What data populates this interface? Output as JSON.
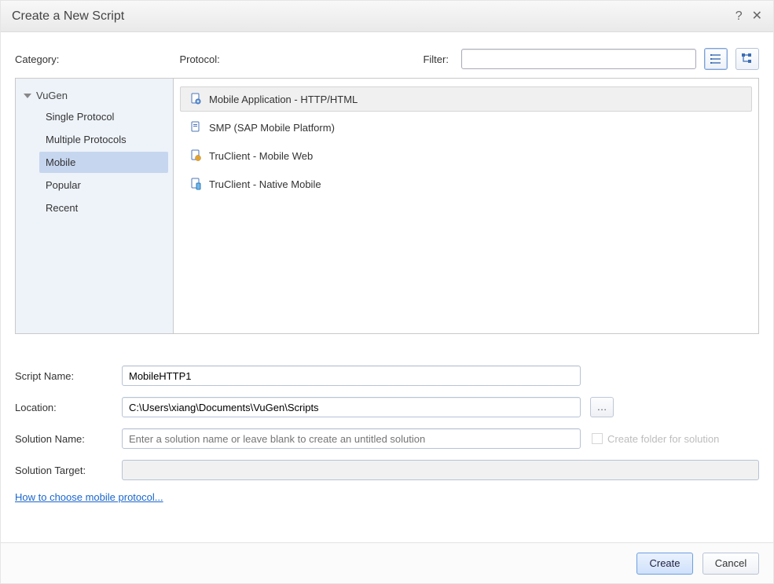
{
  "title": "Create a New Script",
  "labels": {
    "category": "Category:",
    "protocol": "Protocol:",
    "filter": "Filter:",
    "scriptName": "Script Name:",
    "location": "Location:",
    "solutionName": "Solution Name:",
    "solutionTarget": "Solution Target:",
    "createFolder": "Create folder for solution"
  },
  "filter": {
    "value": ""
  },
  "tree": {
    "root": "VuGen",
    "items": [
      {
        "label": "Single Protocol",
        "selected": false
      },
      {
        "label": "Multiple Protocols",
        "selected": false
      },
      {
        "label": "Mobile",
        "selected": true
      },
      {
        "label": "Popular",
        "selected": false
      },
      {
        "label": "Recent",
        "selected": false
      }
    ]
  },
  "protocols": [
    {
      "label": "Mobile Application - HTTP/HTML",
      "icon": "doc-gear",
      "selected": true
    },
    {
      "label": "SMP (SAP Mobile Platform)",
      "icon": "doc",
      "selected": false
    },
    {
      "label": "TruClient - Mobile Web",
      "icon": "doc-globe",
      "selected": false
    },
    {
      "label": "TruClient - Native Mobile",
      "icon": "doc-phone",
      "selected": false
    }
  ],
  "form": {
    "scriptName": "MobileHTTP1",
    "location": "C:\\Users\\xiang\\Documents\\VuGen\\Scripts",
    "solutionPlaceholder": "Enter a solution name or leave blank to create an untitled solution",
    "solutionTarget": ""
  },
  "links": {
    "chooseProtocol": "How to choose mobile protocol..."
  },
  "buttons": {
    "create": "Create",
    "cancel": "Cancel"
  }
}
